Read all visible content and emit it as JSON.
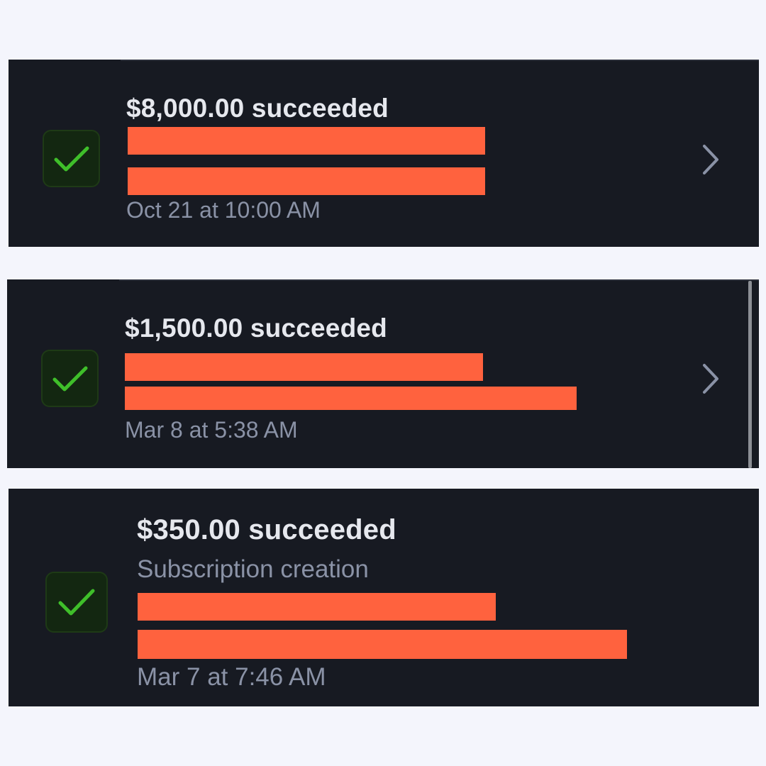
{
  "colors": {
    "page_background": "#f4f5fc",
    "card_background": "#171a22",
    "success_green": "#3fbf2a",
    "redaction": "#ff623e",
    "title_text": "#e6e8ee",
    "secondary_text": "#8a92a6"
  },
  "payments": [
    {
      "amount": "$8,000.00",
      "status": "succeeded",
      "title": "$8,000.00 succeeded",
      "subtitle": "",
      "date": "Oct 21 at 10:00 AM",
      "status_icon": "check-icon",
      "has_chevron": true
    },
    {
      "amount": "$1,500.00",
      "status": "succeeded",
      "title": "$1,500.00 succeeded",
      "subtitle": "",
      "date": "Mar 8 at 5:38 AM",
      "status_icon": "check-icon",
      "has_chevron": true
    },
    {
      "amount": "$350.00",
      "status": "succeeded",
      "title": "$350.00 succeeded",
      "subtitle": "Subscription creation",
      "date": "Mar 7 at 7:46 AM",
      "status_icon": "check-icon",
      "has_chevron": false
    }
  ]
}
